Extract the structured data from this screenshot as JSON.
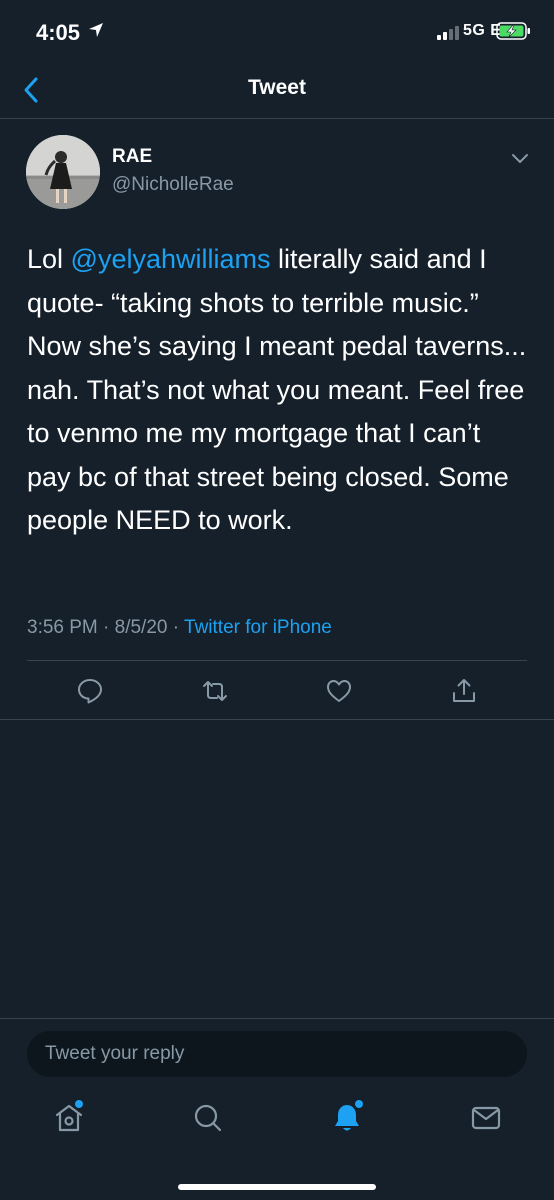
{
  "status_bar": {
    "time": "4:05",
    "network": "5G E",
    "icons": [
      "location-arrow-icon",
      "signal-icon",
      "battery-charging-icon"
    ]
  },
  "nav": {
    "title": "Tweet",
    "back_icon": "chevron-left-icon"
  },
  "tweet": {
    "author_name": "RAE",
    "author_handle": "@NicholleRae",
    "text_before_mention": "Lol ",
    "mention": "@yelyahwilliams",
    "text_after_mention": " literally said and I quote- “taking shots to terrible music.” Now she’s saying I meant pedal taverns... nah. That’s not what you meant. Feel free to venmo me my mortgage that I can’t pay bc of that street being closed. Some people NEED to work.",
    "timestamp": "3:56 PM · 8/5/20 · ",
    "source": "Twitter for iPhone",
    "actions": [
      "reply-icon",
      "retweet-icon",
      "like-icon",
      "share-icon"
    ]
  },
  "reply": {
    "placeholder": "Tweet your reply"
  },
  "tab_bar": {
    "tabs": [
      "home-icon",
      "search-icon",
      "notifications-icon",
      "messages-icon"
    ],
    "active_tab": "notifications-icon"
  },
  "colors": {
    "background": "#15202b",
    "accent": "#1da1f2",
    "secondary_text": "#8899a6",
    "divider": "#38444d"
  }
}
